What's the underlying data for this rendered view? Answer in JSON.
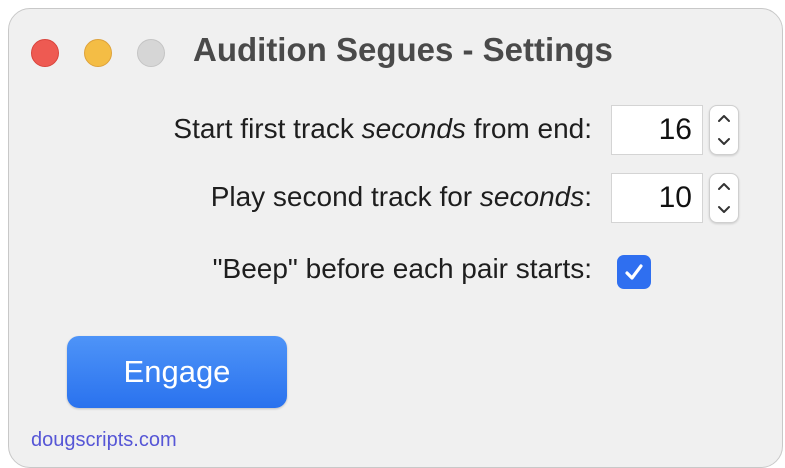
{
  "window": {
    "title": "Audition Segues - Settings"
  },
  "fields": [
    {
      "label_prefix": "Start first track ",
      "label_italic": "seconds",
      "label_suffix": " from end:",
      "value": "16"
    },
    {
      "label_prefix": "Play second track for ",
      "label_italic": "seconds",
      "label_suffix": ":",
      "value": "10"
    }
  ],
  "beep": {
    "label": "\"Beep\" before each pair starts:",
    "checked": true
  },
  "engage_button": {
    "label": "Engage"
  },
  "footer": {
    "link": "dougscripts.com"
  },
  "colors": {
    "accent": "#2f6ff0",
    "close": "#ee5a52",
    "minimize": "#f4bd45",
    "zoom_disabled": "#d6d6d6",
    "link": "#5656d6"
  },
  "icons": {
    "stepper": "chevron-up-down-icon",
    "checkbox": "checkmark-icon"
  }
}
